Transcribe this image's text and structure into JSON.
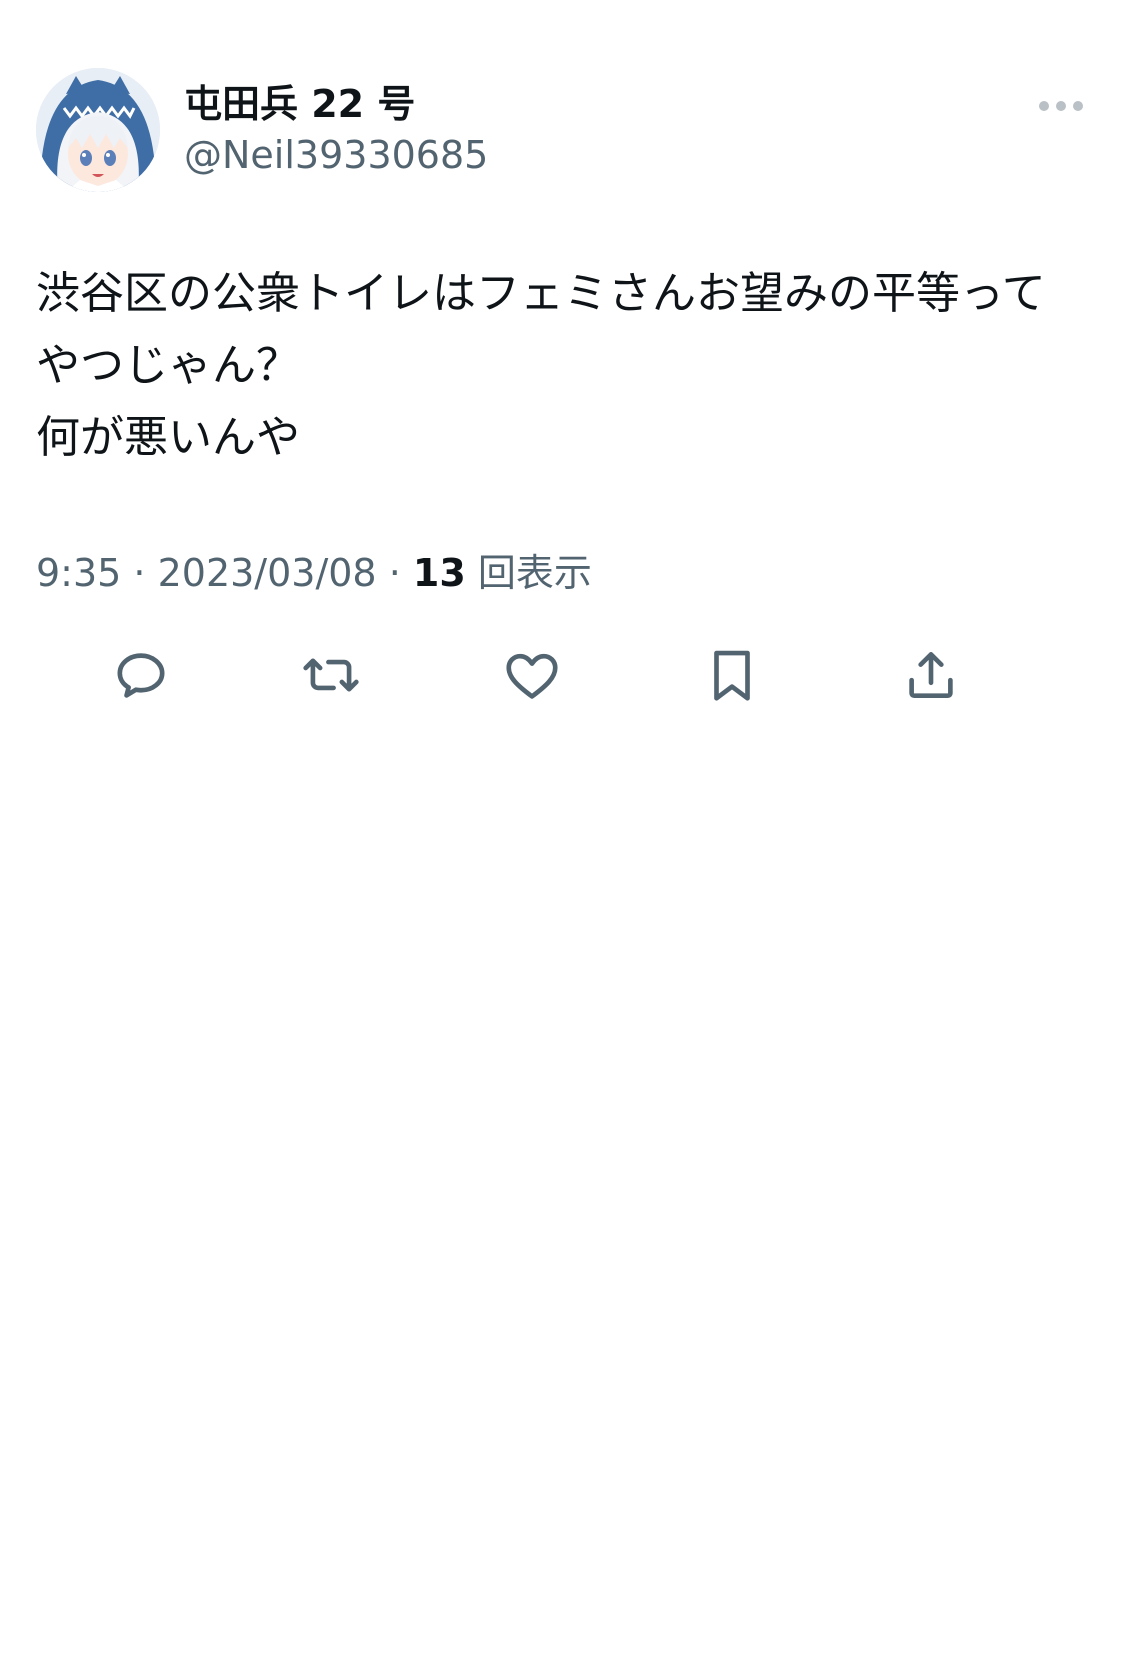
{
  "author": {
    "display_name": "屯田兵 22 号",
    "handle": "@Neil39330685",
    "avatar_description": "anime-avatar"
  },
  "tweet": {
    "lines": [
      "渋谷区の公衆トイレはフェミさんお望みの平等って",
      "やつじゃん？",
      "何が悪いんや"
    ]
  },
  "meta": {
    "time": "9:35",
    "separator": " · ",
    "date": "2023/03/08",
    "views_count": "13",
    "views_label": " 回表示"
  },
  "actions": {
    "reply_icon": "reply-icon",
    "retweet_icon": "retweet-icon",
    "like_icon": "like-icon",
    "bookmark_icon": "bookmark-icon",
    "share_icon": "share-icon"
  },
  "colors": {
    "text_primary": "#0f1419",
    "text_secondary": "#536471",
    "icon": "#536471",
    "background": "#ffffff"
  }
}
